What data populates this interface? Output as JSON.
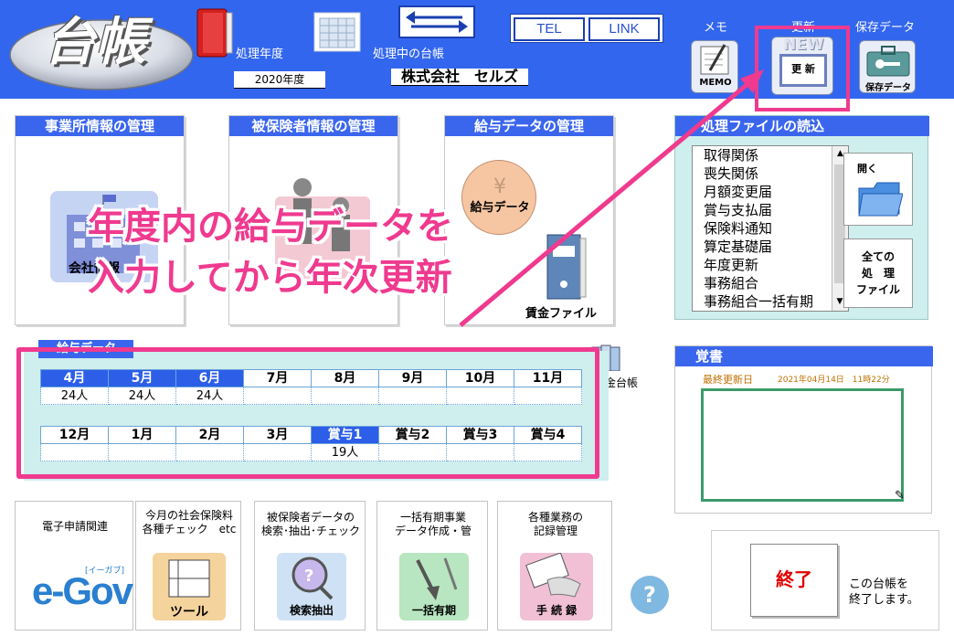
{
  "header": {
    "logo_text": "台帳",
    "fiscal_year_label": "処理年度",
    "fiscal_year_value": "2020年度",
    "current_ledger_label": "処理中の台帳",
    "company_name": "株式会社　セルズ",
    "tel_button": "TEL",
    "link_button": "LINK",
    "memo_label": "メモ",
    "memo_icon_text": "MEMO",
    "update_label": "更新",
    "update_icon_new": "NEW",
    "update_icon_text": "更 新",
    "backup_label": "保存データ",
    "backup_icon_text": "保存データ"
  },
  "panels": {
    "office_title": "事業所情報の管理",
    "office_icon_text": "会社情報",
    "insured_title": "被保険者情報の管理",
    "salary_title": "給与データの管理",
    "salary_icon_text": "給与データ",
    "wage_file_label": "賃金ファイル",
    "ledger_label": "賃金台帳"
  },
  "files": {
    "title": "処理ファイルの読込",
    "items": [
      "取得関係",
      "喪失関係",
      "月額変更届",
      "賞与支払届",
      "保険料通知",
      "算定基礎届",
      "年度更新",
      "事務組合",
      "事務組合一括有期"
    ],
    "open_label": "開く",
    "all_files_label": "全ての\n処　理\nファイル"
  },
  "salary_data": {
    "title": "給与データ",
    "row1_headers": [
      "4月",
      "5月",
      "6月",
      "7月",
      "8月",
      "9月",
      "10月",
      "11月"
    ],
    "row1_values": [
      "24人",
      "24人",
      "24人",
      "",
      "",
      "",
      "",
      ""
    ],
    "row2_headers": [
      "12月",
      "1月",
      "2月",
      "3月",
      "賞与1",
      "賞与2",
      "賞与3",
      "賞与4"
    ],
    "row2_values": [
      "",
      "",
      "",
      "",
      "19人",
      "",
      "",
      ""
    ]
  },
  "notes": {
    "title": "覚書",
    "last_updated_label": "最終更新日",
    "last_updated_value": "2021年04月14日　11時22分"
  },
  "bottom": {
    "egov_title": "電子申請関連",
    "egov_logo": "e-Gov",
    "egov_kana": "[イーガブ]",
    "check_title": "今月の社会保険料\n各種チェック　etc",
    "check_icon_text": "ツール",
    "search_title": "被保険者データの\n検索･抽出･チェック",
    "search_icon_text": "検索抽出",
    "bulk_title": "一括有期事業\nデータ作成・管",
    "bulk_icon_text": "一括有期",
    "records_title": "各種業務の\n記録管理",
    "records_icon_text": "手 続 録",
    "help_icon": "?",
    "exit_button": "終了",
    "exit_description": "この台帳を\n終了します。"
  },
  "overlay": {
    "line1": "年度内の給与データを",
    "line2": "入力してから年次更新"
  },
  "colors": {
    "header_blue": "#3366ee",
    "highlight_pink": "#ef3a8f",
    "title_blue": "#3a66ee"
  }
}
